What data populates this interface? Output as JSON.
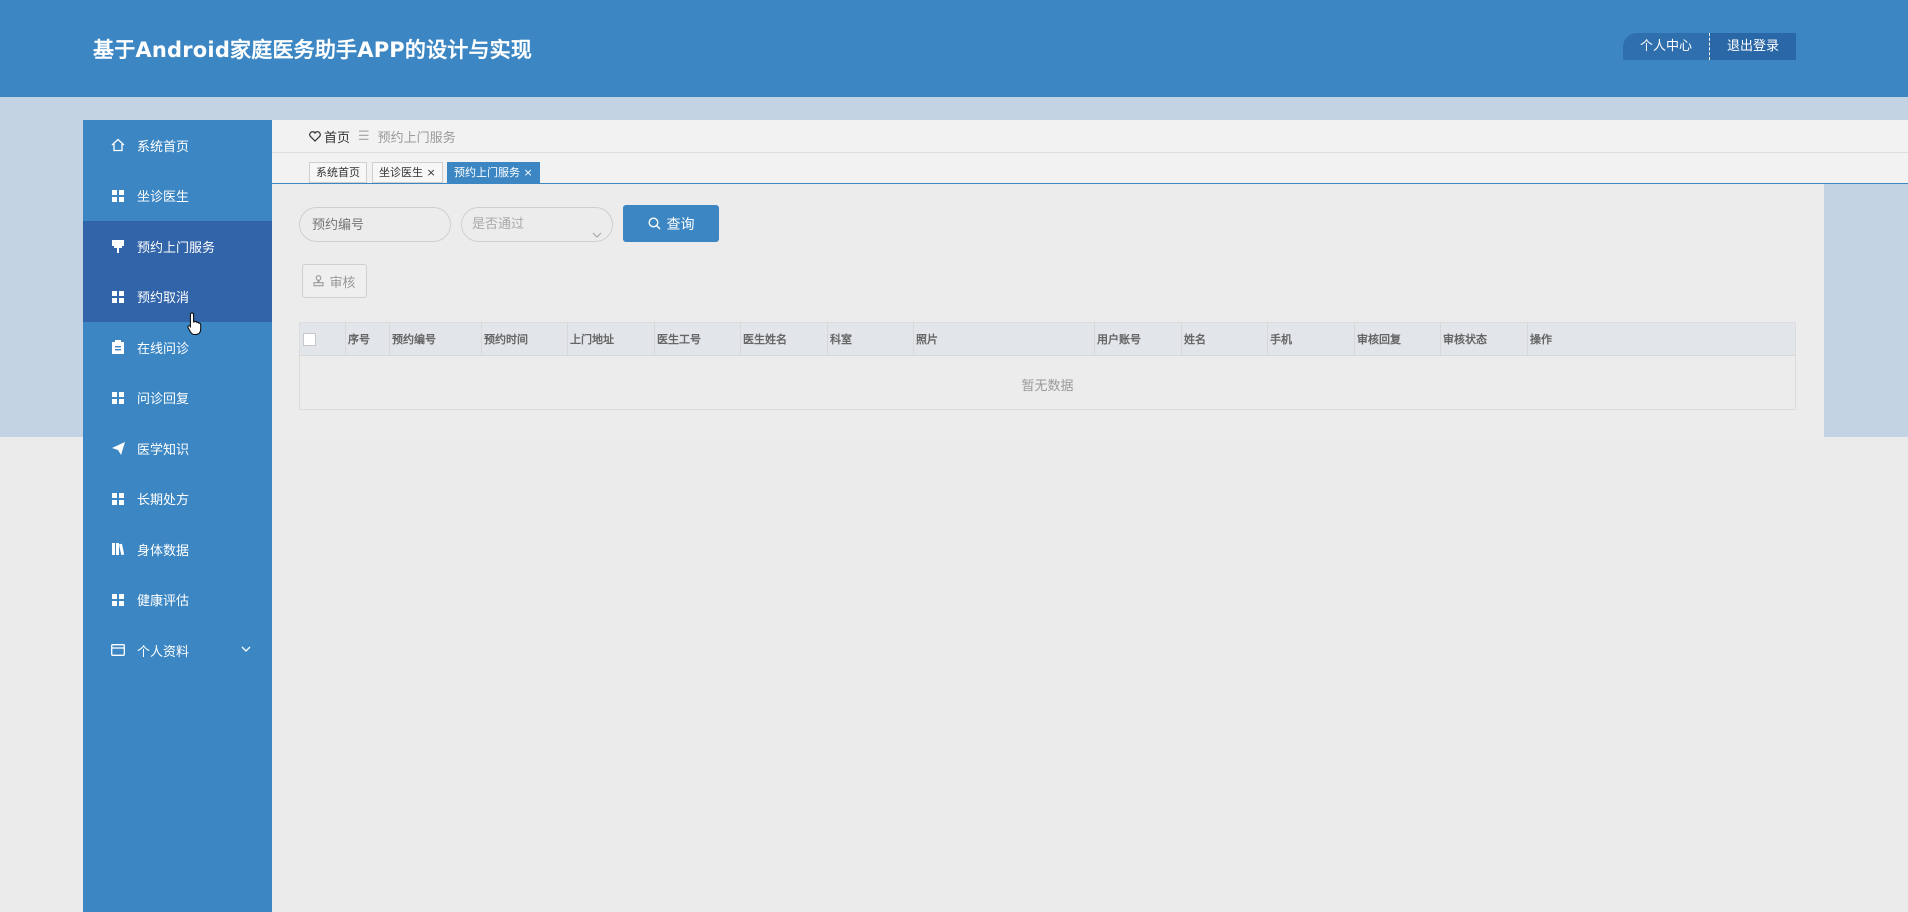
{
  "header": {
    "app_title": "基于Android家庭医务助手APP的设计与实现",
    "personal_center": "个人中心",
    "logout": "退出登录"
  },
  "sidebar": {
    "items": [
      {
        "label": "系统首页",
        "icon": "home-icon"
      },
      {
        "label": "坐诊医生",
        "icon": "grid-icon"
      },
      {
        "label": "预约上门服务",
        "icon": "stamp-icon"
      },
      {
        "label": "预约取消",
        "icon": "grid-icon"
      },
      {
        "label": "在线问诊",
        "icon": "clipboard-icon"
      },
      {
        "label": "问诊回复",
        "icon": "grid-icon"
      },
      {
        "label": "医学知识",
        "icon": "paper-plane-icon"
      },
      {
        "label": "长期处方",
        "icon": "grid-icon"
      },
      {
        "label": "身体数据",
        "icon": "book-icon"
      },
      {
        "label": "健康评估",
        "icon": "grid-icon"
      },
      {
        "label": "个人资料",
        "icon": "card-icon"
      }
    ]
  },
  "breadcrumb": {
    "home": "首页",
    "separator": "☰",
    "current": "预约上门服务"
  },
  "tabs": [
    {
      "label": "系统首页"
    },
    {
      "label": "坐诊医生",
      "close": "×"
    },
    {
      "label": "预约上门服务",
      "close": "×"
    }
  ],
  "search": {
    "booking_number_placeholder": "预约编号",
    "approved_placeholder": "是否通过",
    "query_label": "查询"
  },
  "actions": {
    "audit_label": "审核"
  },
  "table": {
    "columns": [
      "序号",
      "预约编号",
      "预约时间",
      "上门地址",
      "医生工号",
      "医生姓名",
      "科室",
      "照片",
      "用户账号",
      "姓名",
      "手机",
      "审核回复",
      "审核状态",
      "操作"
    ],
    "empty_text": "暂无数据"
  },
  "colors": {
    "primary": "#3c87c3",
    "sidebar_active": "#3264aa",
    "band": "#c3d3e3"
  }
}
